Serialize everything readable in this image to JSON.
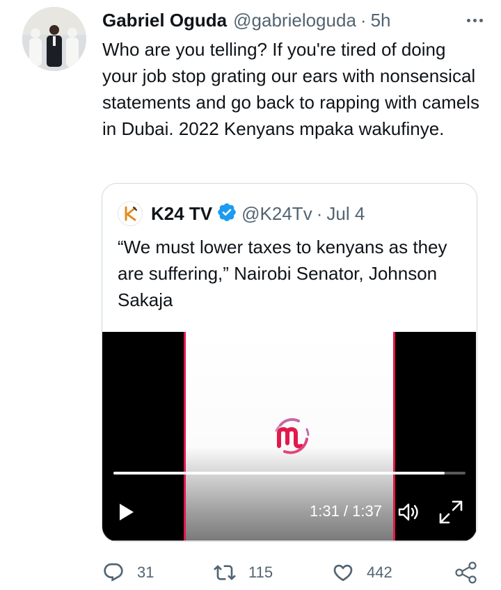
{
  "tweet": {
    "author_name": "Gabriel Oguda",
    "handle": "@gabrieloguda",
    "separator": "·",
    "time": "5h",
    "text": "Who are you telling? If you're tired of doing your job stop grating our ears with nonsensical statements and go back to rapping with camels in Dubai. 2022 Kenyans mpaka wakufinye."
  },
  "quoted": {
    "author_name": "K24 TV",
    "verified": true,
    "handle": "@K24Tv",
    "separator": "·",
    "time": "Jul 4",
    "text": "“We must lower taxes to kenyans as they are suffering,” Nairobi Senator, Johnson Sakaja",
    "video": {
      "time_readout": "1:31 / 1:37",
      "progress": 0.94
    }
  },
  "actions": {
    "replies": "31",
    "retweets": "115",
    "likes": "442"
  },
  "colors": {
    "text": "#0f1419",
    "secondary": "#536471",
    "verified": "#1d9bf0",
    "video_border": "#e0194a"
  },
  "icons": [
    "more-icon",
    "verified-icon",
    "play-icon",
    "volume-icon",
    "fullscreen-icon",
    "reply-icon",
    "retweet-icon",
    "like-icon",
    "share-icon"
  ]
}
